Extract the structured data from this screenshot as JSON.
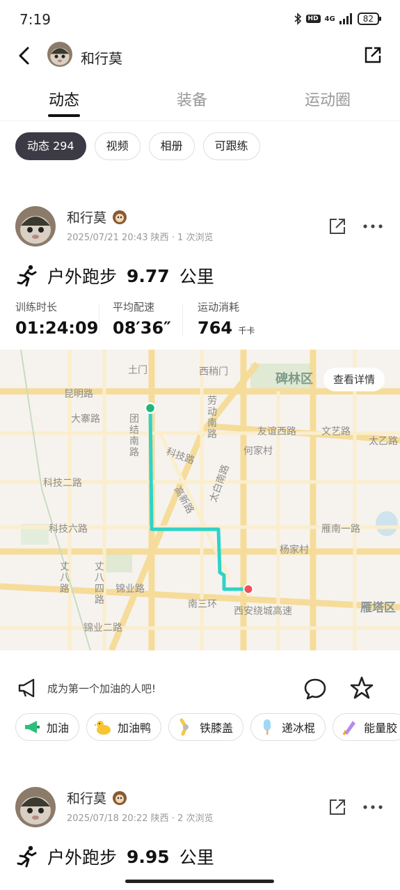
{
  "status_bar": {
    "time": "7:19",
    "network": "4G",
    "hd": "HD",
    "battery": "82"
  },
  "nav": {
    "name": "和行莫"
  },
  "tabs": [
    {
      "label": "动态"
    },
    {
      "label": "装备"
    },
    {
      "label": "运动圈"
    }
  ],
  "chips": [
    {
      "label": "动态 294"
    },
    {
      "label": "视频"
    },
    {
      "label": "相册"
    },
    {
      "label": "可跟练"
    }
  ],
  "posts": [
    {
      "name": "和行莫",
      "meta": "2025/07/21 20:43 陕西 · 1 次浏览",
      "activity": {
        "type": "户外跑步",
        "distance": "9.77",
        "unit": "公里"
      },
      "stats": [
        {
          "label": "训练时长",
          "value": "01:24:09",
          "unit": ""
        },
        {
          "label": "平均配速",
          "value": "08′36″",
          "unit": ""
        },
        {
          "label": "运动消耗",
          "value": "764",
          "unit": "千卡"
        }
      ]
    },
    {
      "name": "和行莫",
      "meta": "2025/07/18 20:22 陕西 · 2 次浏览",
      "activity": {
        "type": "户外跑步",
        "distance": "9.95",
        "unit": "公里"
      }
    }
  ],
  "map": {
    "details_button": "查看详情",
    "labels": {
      "shangmen": "土门",
      "xishaomen": "西稍门",
      "beilin": "碑林区",
      "kunming": "昆明路",
      "dazhai": "大寨路",
      "tuanjie": "团结南路",
      "laodong": "劳动南路",
      "youyi": "友谊西路",
      "wenyi": "文艺路",
      "taiyi": "太乙路",
      "hejiacun": "何家村",
      "keji": "科技路",
      "keji2": "科技二路",
      "gaoxin": "高新路",
      "taibai": "太白南路",
      "keji6": "科技六路",
      "yannan1": "雁南一路",
      "yangjiacun": "杨家村",
      "zhang8": "丈八路",
      "zhang84": "丈八四路",
      "jinye": "锦业路",
      "nansanhuan": "南三环",
      "raocheng": "西安绕城高速",
      "yanta": "雁塔区",
      "jinye2": "锦业二路"
    },
    "colors": {
      "route": "#2ed3c8",
      "start": "#1fb87a",
      "end": "#f0505a"
    }
  },
  "cheer": {
    "text": "成为第一个加油的人吧!"
  },
  "gifts": [
    {
      "label": "加油",
      "icon": "megaphone-icon"
    },
    {
      "label": "加油鸭",
      "icon": "duck-icon"
    },
    {
      "label": "铁膝盖",
      "icon": "knee-icon"
    },
    {
      "label": "递冰棍",
      "icon": "popsicle-icon"
    },
    {
      "label": "能量胶",
      "icon": "energy-gel-icon"
    }
  ]
}
